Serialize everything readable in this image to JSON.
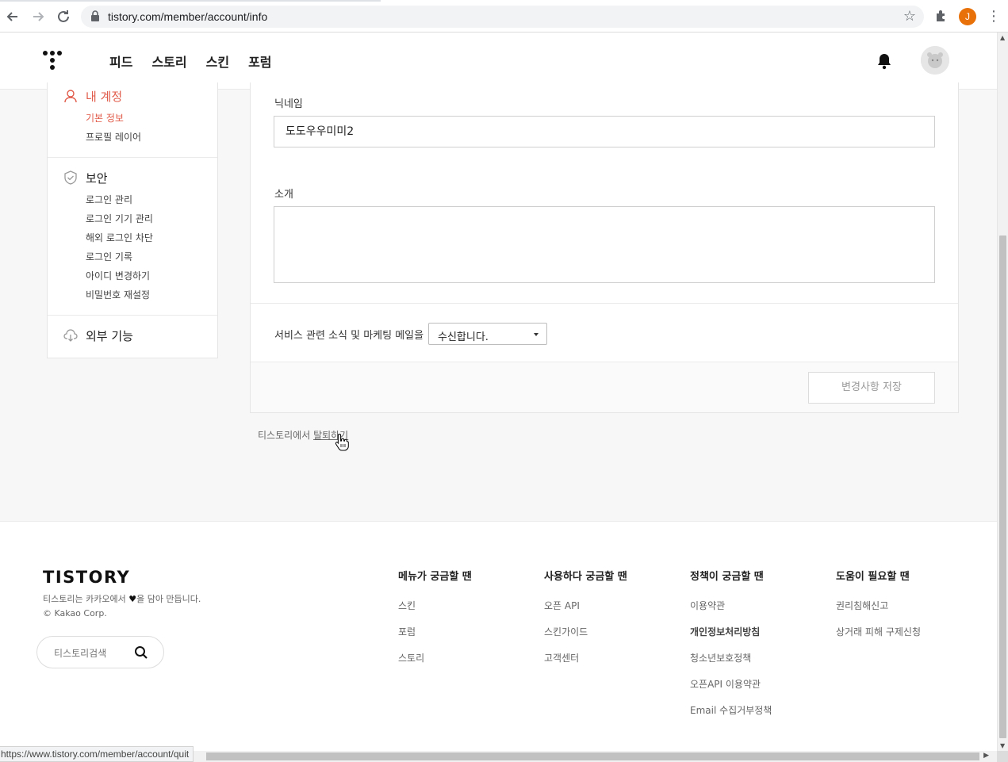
{
  "browser": {
    "url": "tistory.com/member/account/info",
    "profile_initial": "J",
    "status_url": "https://www.tistory.com/member/account/quit"
  },
  "header": {
    "nav": [
      "피드",
      "스토리",
      "스킨",
      "포럼"
    ]
  },
  "sidebar": {
    "account": {
      "title": "내 계정",
      "items": [
        "기본 정보",
        "프로필 레이어"
      ]
    },
    "security": {
      "title": "보안",
      "items": [
        "로그인 관리",
        "로그인 기기 관리",
        "해외 로그인 차단",
        "로그인 기록",
        "아이디 변경하기",
        "비밀번호 재설정"
      ]
    },
    "external": {
      "title": "외부 기능"
    }
  },
  "form": {
    "nickname_label": "닉네임",
    "nickname_value": "도도우우미미2",
    "intro_label": "소개",
    "intro_value": "",
    "mail_label": "서비스 관련 소식 및 마케팅 메일을",
    "mail_selected": "수신합니다.",
    "save_label": "변경사항 저장"
  },
  "quit": {
    "prefix": "티스토리에서 ",
    "link": "탈퇴하기"
  },
  "footer": {
    "logo": "TISTORY",
    "desc_line1_a": "티스토리는 카카오에서 ",
    "desc_line1_b": "을 담아 만듭니다.",
    "desc_line2": "© Kakao Corp.",
    "search_placeholder": "티스토리검색",
    "columns": [
      {
        "head": "메뉴가 궁금할 땐",
        "links": [
          "스킨",
          "포럼",
          "스토리"
        ]
      },
      {
        "head": "사용하다 궁금할 땐",
        "links": [
          "오픈 API",
          "스킨가이드",
          "고객센터"
        ]
      },
      {
        "head": "정책이 궁금할 땐",
        "links": [
          "이용약관",
          "개인정보처리방침",
          "청소년보호정책",
          "오픈API 이용약관",
          "Email 수집거부정책"
        ]
      },
      {
        "head": "도움이 필요할 땐",
        "links": [
          "권리침해신고",
          "상거래 피해 구제신청"
        ]
      }
    ]
  },
  "colors": {
    "accent": "#e15b4a",
    "text": "#222222"
  }
}
